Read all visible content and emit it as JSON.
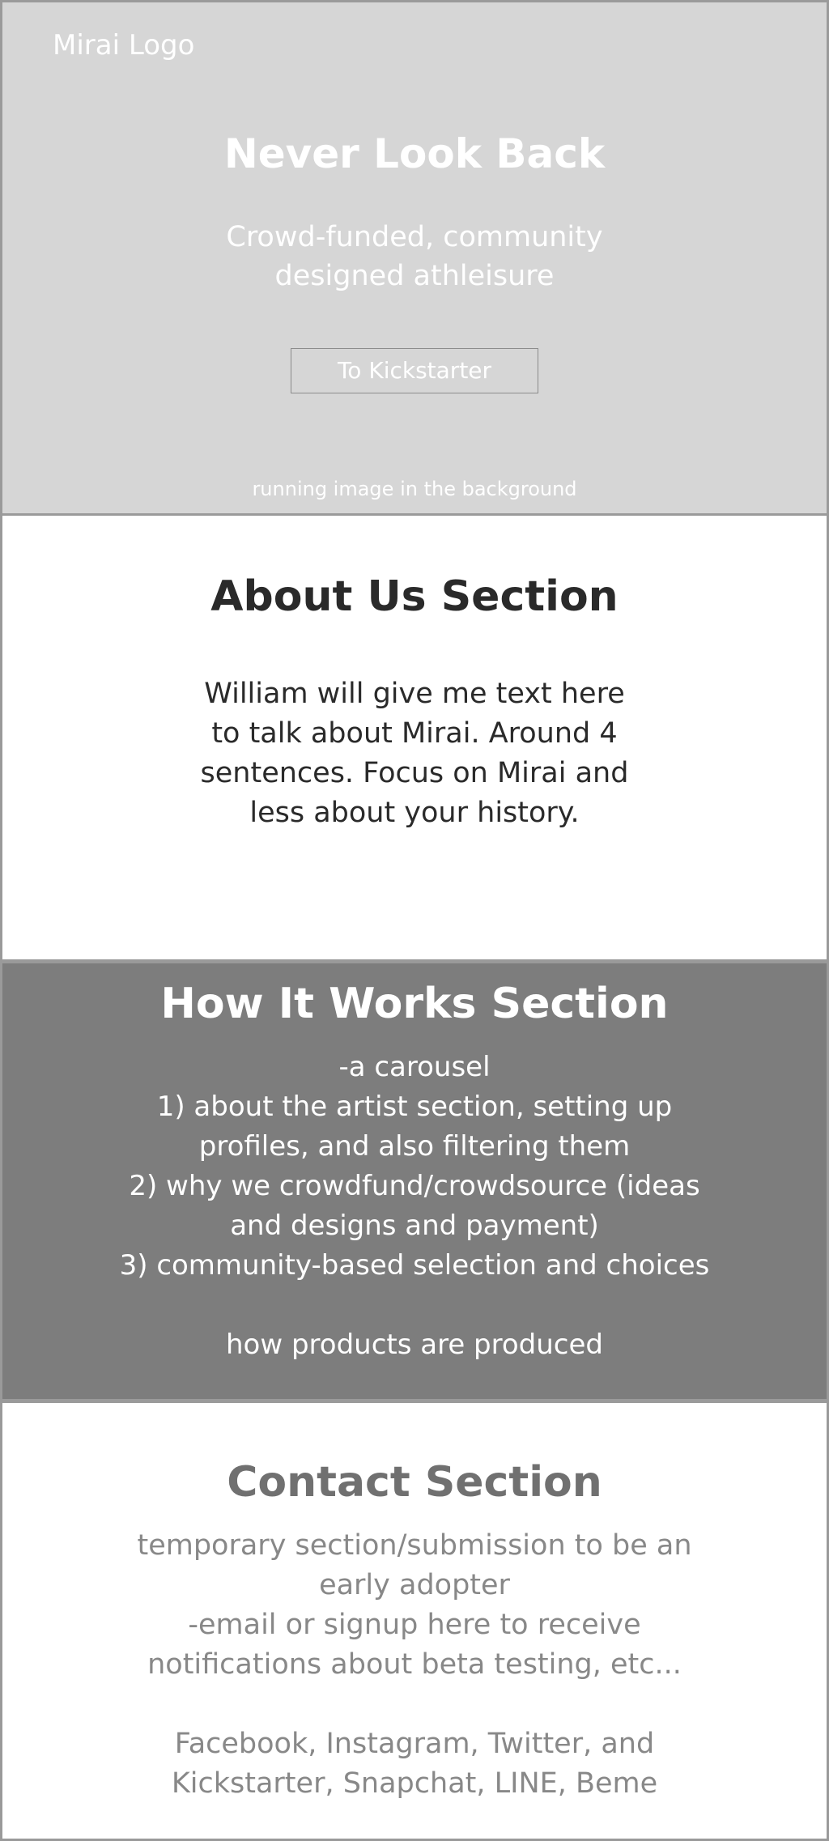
{
  "hero": {
    "logo": "Mirai Logo",
    "title": "Never Look Back",
    "subtitle": "Crowd-funded, community designed athleisure",
    "cta_label": "To Kickstarter",
    "note": "running image in the background"
  },
  "about": {
    "title": "About Us Section",
    "body": "William will give me text here to talk about Mirai. Around 4 sentences. Focus on Mirai and less about your history."
  },
  "how_it_works": {
    "title": "How It Works Section",
    "lines": [
      "-a carousel",
      "1) about the artist section, setting up profiles, and also filtering them",
      "2) why we crowdfund/crowdsource (ideas and designs and payment)",
      "3) community-based selection and choices",
      "",
      "how products are produced"
    ]
  },
  "contact": {
    "title": "Contact Section",
    "lines": [
      "temporary section/submission to be an early adopter",
      "-email or signup here to receive notifications about beta testing, etc..."
    ],
    "social": "Facebook, Instagram, Twitter, and Kickstarter, Snapchat, LINE, Beme"
  }
}
